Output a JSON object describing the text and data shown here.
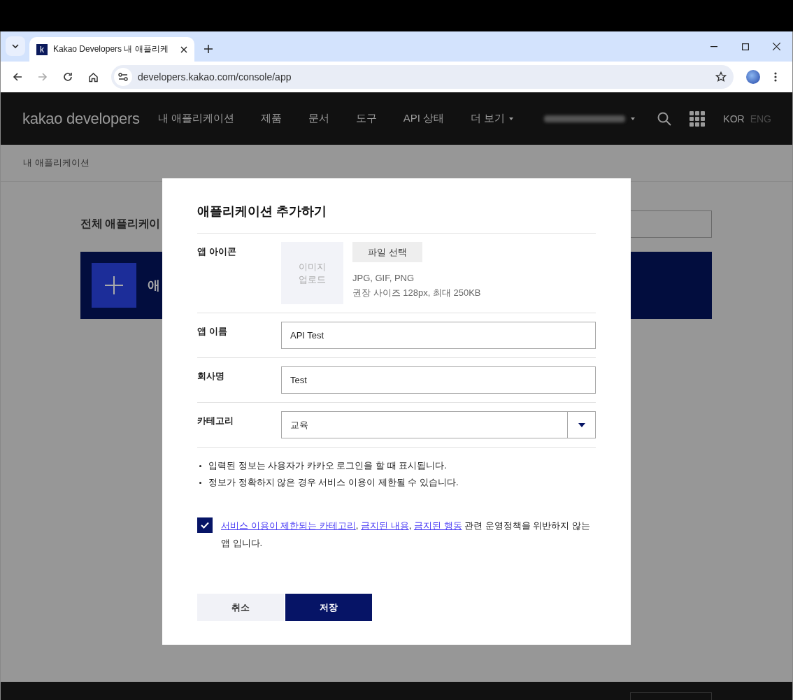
{
  "browser": {
    "tabs": [
      {
        "favicon": "k",
        "title": "Kakao Developers 내 애플리케",
        "selected": true
      }
    ],
    "address": "developers.kakao.com/console/app"
  },
  "header": {
    "logo": "kakao developers",
    "nav": [
      {
        "label": "내 애플리케이션",
        "dropdown": false
      },
      {
        "label": "제품",
        "dropdown": false
      },
      {
        "label": "문서",
        "dropdown": false
      },
      {
        "label": "도구",
        "dropdown": false
      },
      {
        "label": "API 상태",
        "dropdown": false
      },
      {
        "label": "더 보기",
        "dropdown": true
      }
    ],
    "languages": [
      {
        "label": "KOR",
        "selected": true
      },
      {
        "label": "ENG",
        "selected": false
      }
    ]
  },
  "breadcrumb": "내 애플리케이션",
  "page": {
    "heading": "전체 애플리케이",
    "add_card_label": "애"
  },
  "dialog": {
    "title": "애플리케이션 추가하기",
    "icon_row": {
      "label": "앱 아이콘",
      "upload_hint": "이미지 업로드",
      "button": "파일 선택",
      "formats": "JPG, GIF, PNG",
      "size_note": "권장 사이즈 128px, 최대 250KB"
    },
    "fields": [
      {
        "kind": "text",
        "label": "앱 이름",
        "value": "API Test"
      },
      {
        "kind": "text",
        "label": "회사명",
        "value": "Test"
      },
      {
        "kind": "select",
        "label": "카테고리",
        "value": "교육"
      }
    ],
    "notes": [
      "입력된 정보는 사용자가 카카오 로그인을 할 때 표시됩니다.",
      "정보가 정확하지 않은 경우 서비스 이용이 제한될 수 있습니다."
    ],
    "agreement": {
      "checked": true,
      "segments": [
        {
          "text": "서비스 이용이 제한되는 카테고리",
          "link": true
        },
        {
          "text": ", ",
          "link": false
        },
        {
          "text": "금지된 내용",
          "link": true
        },
        {
          "text": ", ",
          "link": false
        },
        {
          "text": "금지된 행동",
          "link": true
        },
        {
          "text": " 관련 운영정책을 위반하지 않는 앱 입니다.",
          "link": false
        }
      ]
    },
    "buttons": [
      {
        "label": "취소",
        "primary": false
      },
      {
        "label": "저장",
        "primary": true
      }
    ]
  }
}
